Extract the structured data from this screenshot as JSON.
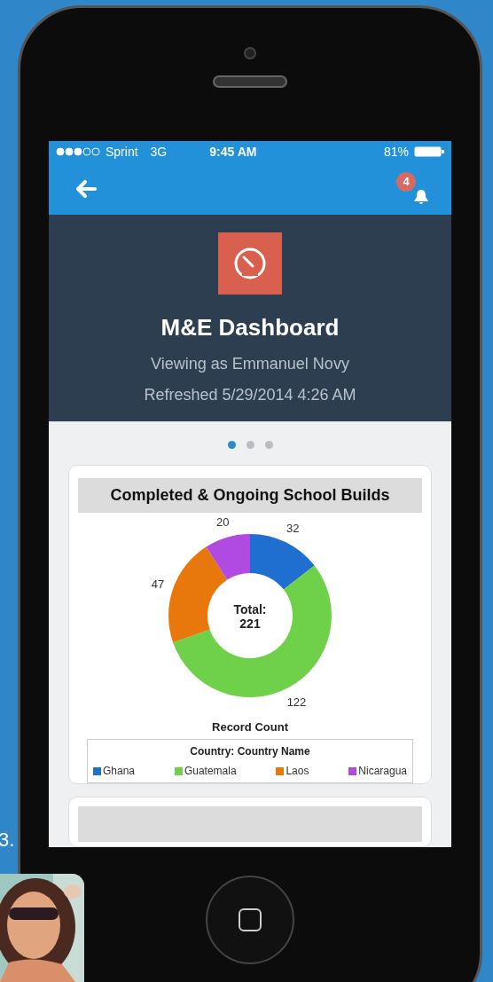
{
  "status_bar": {
    "carrier": "Sprint",
    "network": "3G",
    "time": "9:45 AM",
    "battery": "81%"
  },
  "nav": {
    "notifications": "4"
  },
  "header": {
    "title": "M&E Dashboard",
    "subtitle": "Viewing as Emmanuel Novy",
    "refreshed": "Refreshed 5/29/2014 4:26 AM"
  },
  "pager": [
    {
      "selected": true
    },
    {
      "selected": false
    },
    {
      "selected": false
    }
  ],
  "card": {
    "chart_data": {
      "type": "donut",
      "title": "Completed & Ongoing School Builds",
      "categories": [
        "Ghana",
        "Guatemala",
        "Laos",
        "Nicaragua"
      ],
      "series": [
        {
          "name": "Record Count",
          "values": [
            32,
            122,
            47,
            20
          ]
        }
      ],
      "data_labels": true,
      "legend": {
        "title": "Country: Country Name"
      }
    },
    "center_label": "Total:",
    "center_value": "221",
    "colors": [
      {
        "color": "#1f6fd1"
      },
      {
        "color": "#6fd14a"
      },
      {
        "color": "#e8780c"
      },
      {
        "color": "#b04ae0"
      }
    ]
  },
  "slide_number": "3."
}
